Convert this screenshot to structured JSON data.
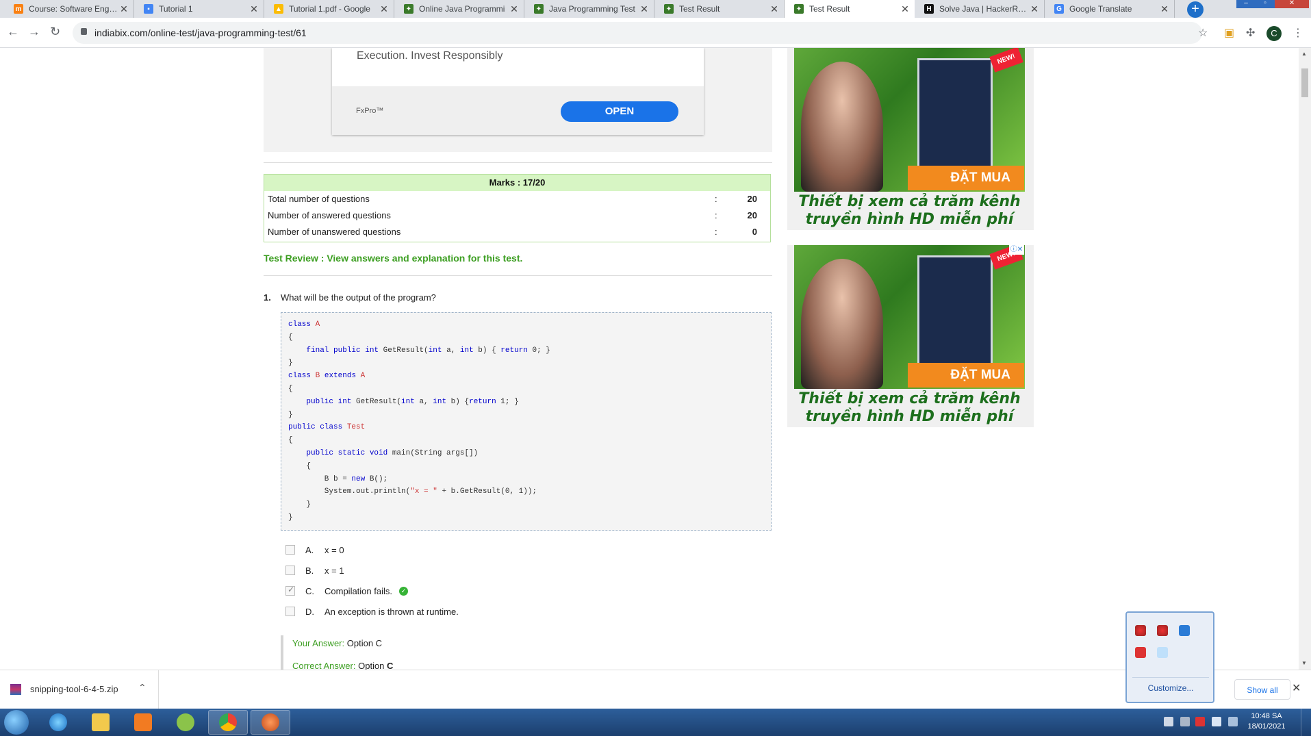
{
  "tabs": [
    {
      "label": "Course: Software Engine",
      "favicon": "moodle-icon",
      "color": "#f98012"
    },
    {
      "label": "Tutorial 1",
      "favicon": "person-doc-icon",
      "color": "#4285f4"
    },
    {
      "label": "Tutorial 1.pdf - Google",
      "favicon": "google-drive-icon",
      "color": "#fbbc04"
    },
    {
      "label": "Online Java Programmi",
      "favicon": "indiabix-icon",
      "color": "#3a7a2a"
    },
    {
      "label": "Java Programming Test",
      "favicon": "indiabix-icon",
      "color": "#3a7a2a"
    },
    {
      "label": "Test Result",
      "favicon": "indiabix-icon",
      "color": "#3a7a2a"
    },
    {
      "label": "Test Result",
      "favicon": "indiabix-icon",
      "color": "#3a7a2a",
      "active": true
    },
    {
      "label": "Solve Java | HackerRank",
      "favicon": "hackerrank-icon",
      "color": "#111111"
    },
    {
      "label": "Google Translate",
      "favicon": "google-translate-icon",
      "color": "#4285f4"
    }
  ],
  "new_tab": "+",
  "address": {
    "url": "indiabix.com/online-test/java-programming-test/61"
  },
  "profile": {
    "initial": "C"
  },
  "ad_top": {
    "text": "Execution. Invest Responsibly",
    "brand": "FxPro™",
    "button": "OPEN"
  },
  "marks": {
    "title": "Marks : 17/20",
    "rows": [
      {
        "label": "Total number of questions",
        "sep": ":",
        "value": "20"
      },
      {
        "label": "Number of answered questions",
        "sep": ":",
        "value": "20"
      },
      {
        "label": "Number of unanswered questions",
        "sep": ":",
        "value": "0"
      }
    ]
  },
  "review": {
    "link": "Test Review : View answers and explanation for this test."
  },
  "question": {
    "number": "1.",
    "text": "What will be the output of the program?",
    "options": [
      {
        "letter": "A.",
        "text": "x = 0",
        "checked": false
      },
      {
        "letter": "B.",
        "text": "x = 1",
        "checked": false
      },
      {
        "letter": "C.",
        "text": "Compilation fails.",
        "checked": true,
        "correct": true
      },
      {
        "letter": "D.",
        "text": "An exception is thrown at runtime.",
        "checked": false
      }
    ],
    "your_answer_label": "Your Answer:",
    "your_answer_value": "Option C",
    "correct_answer_label": "Correct Answer:",
    "correct_answer_value": "Option ",
    "correct_answer_letter": "C"
  },
  "side_ads": [
    {
      "badge": "NEW!",
      "buy": "ĐẶT MUA",
      "caption": "Thiết bị xem cả trăm kênh truyền hình HD miễn phí"
    },
    {
      "badge": "NEW!",
      "buy": "ĐẶT MUA",
      "caption": "Thiết bị xem cả trăm kênh truyền hình HD miễn phí"
    }
  ],
  "download": {
    "filename": "snipping-tool-6-4-5.zip",
    "show_all": "Show all"
  },
  "tray_popup": {
    "customize": "Customize..."
  },
  "clock": {
    "time": "10:48 SA",
    "date": "18/01/2021"
  },
  "colors": {
    "accent_green": "#3c9e21",
    "marks_header_bg": "#d7f5c4",
    "open_button": "#1a73e8"
  }
}
